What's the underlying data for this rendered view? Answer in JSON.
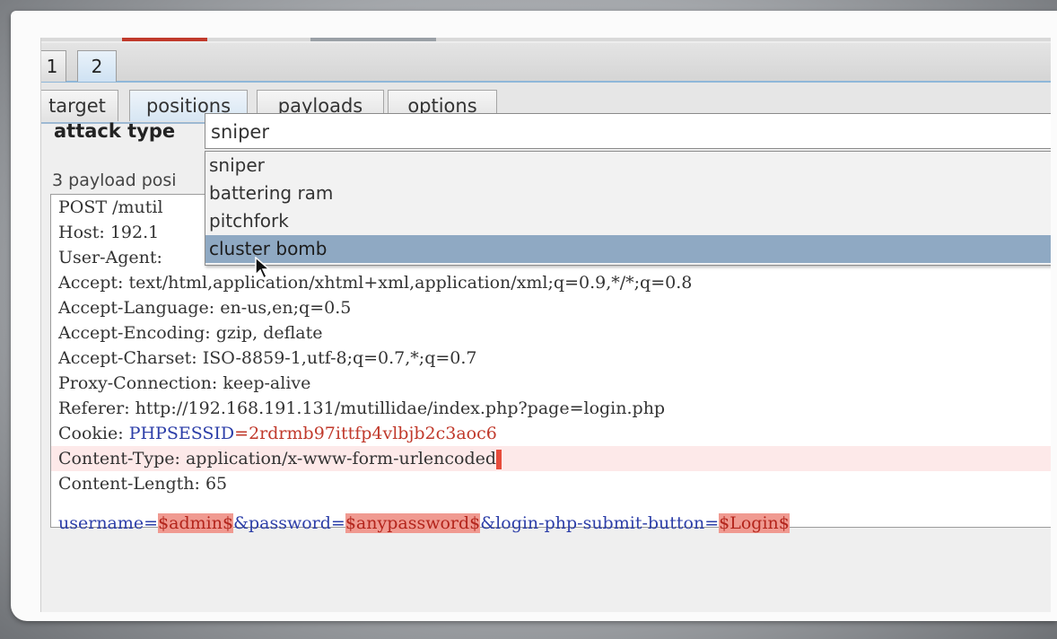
{
  "request_tabs": [
    "1",
    "2"
  ],
  "subtabs": [
    "target",
    "positions",
    "payloads",
    "options"
  ],
  "active_subtab": "positions",
  "attack_type": {
    "label": "attack type",
    "value": "sniper",
    "options": [
      "sniper",
      "battering ram",
      "pitchfork",
      "cluster bomb"
    ],
    "highlighted": "cluster bomb"
  },
  "payload_positions_text": "3 payload posi",
  "request_lines": {
    "l1": "POST /mutil",
    "l2": "Host: 192.1",
    "l3": "User-Agent:",
    "l4": "Accept: text/html,application/xhtml+xml,application/xml;q=0.9,*/*;q=0.8",
    "l5": "Accept-Language: en-us,en;q=0.5",
    "l6": "Accept-Encoding: gzip, deflate",
    "l7": "Accept-Charset: ISO-8859-1,utf-8;q=0.7,*;q=0.7",
    "l8": "Proxy-Connection: keep-alive",
    "l9": "Referer: http://192.168.191.131/mutillidae/index.php?page=login.php",
    "cookie_prefix": "Cookie: ",
    "cookie_name": "PHPSESSID",
    "cookie_eq": "=",
    "cookie_value": "2rdrmb97ittfp4vlbjb2c3aoc6",
    "l11": "Content-Type: application/x-www-form-urlencoded",
    "l12": "Content-Length: 65",
    "body_username_key": "username=",
    "body_username_val": "$admin$",
    "body_password_key": "&password=",
    "body_password_val": "$anypassword$",
    "body_submit_key": "&login-php-submit-button=",
    "body_submit_val": "$Login$"
  },
  "colors": {
    "tab_accent": "#8fb7d9",
    "selection": "#8fa9c3",
    "payload_marker": "#f09a91",
    "cookie_name": "#2c3ea8",
    "cookie_value": "#c0392b"
  }
}
